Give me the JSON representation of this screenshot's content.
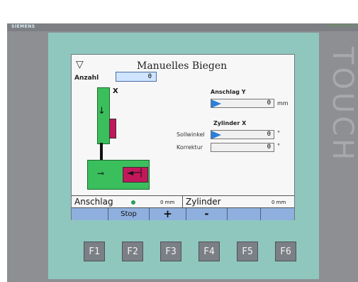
{
  "device": {
    "brand_left": "SIEMENS",
    "brand_right": "SIMATIC PANEL",
    "touch_label": "TOUCH"
  },
  "screen": {
    "title": "Manuelles Biegen",
    "anzahl_label": "Anzahl",
    "anzahl_value": "0",
    "diagram_x_label": "X",
    "anschlag_y": {
      "label": "Anschlag Y",
      "value": "0",
      "unit": "mm"
    },
    "zylinder_x": {
      "label": "Zylinder X",
      "sollwinkel_label": "Sollwinkel",
      "sollwinkel_value": "0",
      "sollwinkel_unit": "°",
      "korrektur_label": "Korrektur",
      "korrektur_value": "0",
      "korrektur_unit": "°"
    },
    "status": {
      "anschlag_label": "Anschlag",
      "anschlag_value": "0 mm",
      "zylinder_label": "Zylinder",
      "zylinder_value": "0 mm"
    },
    "softkeys": [
      "",
      "Stop",
      "+",
      "-",
      "",
      ""
    ]
  },
  "function_keys": [
    "F1",
    "F2",
    "F3",
    "F4",
    "F5",
    "F6"
  ],
  "colors": {
    "panel_bg": "#8fc7bf",
    "accent_blue": "#2a7fd8",
    "green": "#3bbf5d",
    "magenta": "#c2185b"
  }
}
